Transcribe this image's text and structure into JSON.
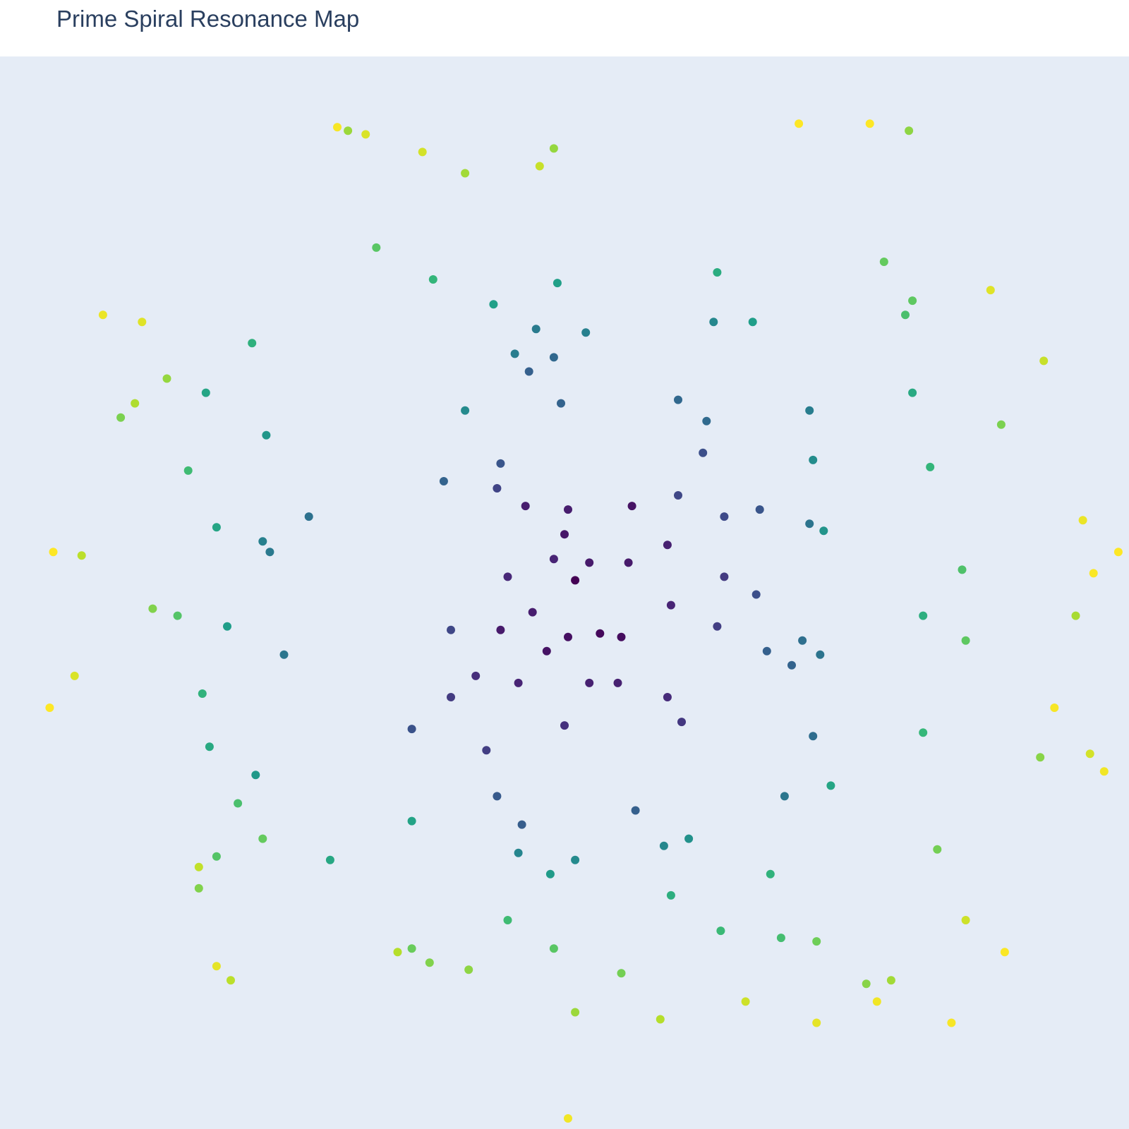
{
  "chart_data": {
    "type": "scatter",
    "title": "Prime Spiral Resonance Map",
    "xlabel": "",
    "ylabel": "",
    "xlim": [
      -16.4,
      15.4
    ],
    "ylim": [
      -15.4,
      14.9
    ],
    "grid": false,
    "legend": "none",
    "colorscale": "viridis",
    "plot_bgcolor": "#e5ecf6",
    "points": [
      [
        -0.2,
        0.1,
        0.0
      ],
      [
        0.5,
        -1.4,
        0.02
      ],
      [
        1.1,
        -1.5,
        0.03
      ],
      [
        -0.4,
        -1.5,
        0.04
      ],
      [
        -1.0,
        -1.9,
        0.05
      ],
      [
        -2.3,
        -1.3,
        0.07
      ],
      [
        1.4,
        2.2,
        0.05
      ],
      [
        -0.5,
        1.4,
        0.06
      ],
      [
        1.3,
        0.6,
        0.07
      ],
      [
        0.2,
        0.6,
        0.07
      ],
      [
        -1.4,
        -0.8,
        0.08
      ],
      [
        -0.4,
        2.1,
        0.08
      ],
      [
        -1.6,
        2.2,
        0.08
      ],
      [
        2.4,
        1.1,
        0.09
      ],
      [
        -1.8,
        -2.8,
        0.1
      ],
      [
        0.2,
        -2.8,
        0.09
      ],
      [
        1.0,
        -2.8,
        0.09
      ],
      [
        2.5,
        -0.6,
        0.1
      ],
      [
        -2.1,
        0.2,
        0.11
      ],
      [
        -0.8,
        0.7,
        0.1
      ],
      [
        2.4,
        -3.2,
        0.12
      ],
      [
        -3.0,
        -2.6,
        0.13
      ],
      [
        -0.5,
        -4.0,
        0.14
      ],
      [
        2.8,
        -3.9,
        0.16
      ],
      [
        -3.7,
        -3.2,
        0.17
      ],
      [
        -2.7,
        -4.7,
        0.18
      ],
      [
        4.0,
        0.2,
        0.17
      ],
      [
        3.8,
        -1.2,
        0.18
      ],
      [
        -2.4,
        2.7,
        0.2
      ],
      [
        -3.7,
        -1.3,
        0.21
      ],
      [
        2.7,
        2.5,
        0.21
      ],
      [
        4.0,
        1.9,
        0.22
      ],
      [
        4.9,
        -0.3,
        0.24
      ],
      [
        -4.8,
        -4.1,
        0.25
      ],
      [
        3.4,
        3.7,
        0.24
      ],
      [
        5.0,
        2.1,
        0.26
      ],
      [
        -2.3,
        3.4,
        0.26
      ],
      [
        -2.4,
        -6.0,
        0.28
      ],
      [
        -1.7,
        -6.8,
        0.29
      ],
      [
        1.5,
        -6.4,
        0.3
      ],
      [
        5.2,
        -1.9,
        0.3
      ],
      [
        5.9,
        -2.3,
        0.31
      ],
      [
        -1.5,
        6.0,
        0.3
      ],
      [
        -3.9,
        2.9,
        0.31
      ],
      [
        -0.6,
        5.1,
        0.31
      ],
      [
        -0.8,
        6.4,
        0.33
      ],
      [
        2.7,
        5.2,
        0.33
      ],
      [
        6.5,
        -4.3,
        0.35
      ],
      [
        3.5,
        4.6,
        0.34
      ],
      [
        6.2,
        -1.6,
        0.36
      ],
      [
        -7.7,
        1.9,
        0.37
      ],
      [
        6.7,
        -2.0,
        0.38
      ],
      [
        6.4,
        1.7,
        0.38
      ],
      [
        -8.4,
        -2.0,
        0.39
      ],
      [
        -8.8,
        0.9,
        0.4
      ],
      [
        5.7,
        -6.0,
        0.39
      ],
      [
        -1.3,
        7.2,
        0.41
      ],
      [
        -1.9,
        6.5,
        0.42
      ],
      [
        0.1,
        7.1,
        0.43
      ],
      [
        6.4,
        4.9,
        0.42
      ],
      [
        -9.0,
        1.2,
        0.43
      ],
      [
        -1.8,
        -7.6,
        0.45
      ],
      [
        2.3,
        -7.4,
        0.46
      ],
      [
        -0.2,
        -7.8,
        0.47
      ],
      [
        3.7,
        7.4,
        0.46
      ],
      [
        -3.3,
        4.9,
        0.47
      ],
      [
        6.5,
        3.5,
        0.48
      ],
      [
        3.0,
        -7.2,
        0.5
      ],
      [
        6.8,
        1.5,
        0.51
      ],
      [
        -8.9,
        4.2,
        0.52
      ],
      [
        -9.2,
        -5.4,
        0.53
      ],
      [
        -0.9,
        -8.2,
        0.54
      ],
      [
        4.8,
        7.4,
        0.55
      ],
      [
        -10.0,
        -1.2,
        0.55
      ],
      [
        -2.5,
        7.9,
        0.56
      ],
      [
        -0.7,
        8.5,
        0.56
      ],
      [
        -4.8,
        -6.7,
        0.57
      ],
      [
        7.0,
        -5.7,
        0.58
      ],
      [
        -10.3,
        1.6,
        0.58
      ],
      [
        -10.6,
        5.4,
        0.58
      ],
      [
        -7.1,
        -7.8,
        0.59
      ],
      [
        9.3,
        5.4,
        0.6
      ],
      [
        -10.5,
        -4.6,
        0.6
      ],
      [
        3.8,
        8.8,
        0.61
      ],
      [
        2.5,
        -8.8,
        0.62
      ],
      [
        9.6,
        -0.9,
        0.62
      ],
      [
        -9.3,
        6.8,
        0.63
      ],
      [
        5.3,
        -8.2,
        0.64
      ],
      [
        -10.7,
        -3.1,
        0.64
      ],
      [
        9.8,
        3.3,
        0.65
      ],
      [
        -4.2,
        8.6,
        0.65
      ],
      [
        9.6,
        -4.2,
        0.66
      ],
      [
        3.9,
        -9.8,
        0.67
      ],
      [
        -2.1,
        -9.5,
        0.68
      ],
      [
        -11.1,
        3.2,
        0.68
      ],
      [
        5.6,
        -10.0,
        0.69
      ],
      [
        -9.7,
        -6.2,
        0.7
      ],
      [
        9.1,
        7.6,
        0.7
      ],
      [
        10.7,
        0.4,
        0.71
      ],
      [
        -11.4,
        -0.9,
        0.72
      ],
      [
        -10.3,
        -7.7,
        0.72
      ],
      [
        -5.8,
        9.5,
        0.73
      ],
      [
        -0.8,
        -10.3,
        0.73
      ],
      [
        10.8,
        -1.6,
        0.74
      ],
      [
        9.3,
        8.0,
        0.74
      ],
      [
        -9.0,
        -7.2,
        0.75
      ],
      [
        8.5,
        9.1,
        0.75
      ],
      [
        -4.8,
        -10.3,
        0.76
      ],
      [
        6.6,
        -10.1,
        0.77
      ],
      [
        1.1,
        -11.0,
        0.78
      ],
      [
        10.0,
        -7.5,
        0.78
      ],
      [
        -13.0,
        4.7,
        0.79
      ],
      [
        -12.1,
        -0.7,
        0.8
      ],
      [
        11.8,
        4.5,
        0.79
      ],
      [
        -10.8,
        -8.6,
        0.8
      ],
      [
        -4.3,
        -10.7,
        0.8
      ],
      [
        8.0,
        -11.3,
        0.81
      ],
      [
        12.9,
        -4.9,
        0.81
      ],
      [
        -3.2,
        -10.9,
        0.82
      ],
      [
        -11.7,
        5.8,
        0.83
      ],
      [
        -0.8,
        12.3,
        0.83
      ],
      [
        9.2,
        12.8,
        0.82
      ],
      [
        -6.6,
        12.8,
        0.84
      ],
      [
        -0.2,
        -12.1,
        0.84
      ],
      [
        -3.3,
        11.6,
        0.85
      ],
      [
        8.7,
        -11.2,
        0.85
      ],
      [
        13.9,
        -0.9,
        0.86
      ],
      [
        -12.6,
        5.1,
        0.87
      ],
      [
        2.2,
        -12.3,
        0.88
      ],
      [
        -5.2,
        -10.4,
        0.88
      ],
      [
        -14.1,
        0.8,
        0.89
      ],
      [
        -9.9,
        -11.2,
        0.89
      ],
      [
        -10.8,
        -8.0,
        0.9
      ],
      [
        -1.2,
        11.8,
        0.91
      ],
      [
        13.0,
        6.3,
        0.91
      ],
      [
        4.6,
        -11.8,
        0.92
      ],
      [
        10.8,
        -9.5,
        0.92
      ],
      [
        -4.5,
        12.2,
        0.93
      ],
      [
        14.3,
        -4.8,
        0.93
      ],
      [
        -6.1,
        12.7,
        0.94
      ],
      [
        -14.3,
        -2.6,
        0.94
      ],
      [
        -12.4,
        7.4,
        0.95
      ],
      [
        11.5,
        8.3,
        0.95
      ],
      [
        6.6,
        -12.4,
        0.96
      ],
      [
        -10.3,
        -10.8,
        0.96
      ],
      [
        14.1,
        1.8,
        0.97
      ],
      [
        -13.5,
        7.6,
        0.97
      ],
      [
        14.7,
        -5.3,
        0.98
      ],
      [
        -0.4,
        -15.1,
        0.98
      ],
      [
        8.3,
        -11.8,
        0.98
      ],
      [
        -6.9,
        12.9,
        0.99
      ],
      [
        13.3,
        -3.5,
        0.99
      ],
      [
        11.9,
        -10.4,
        0.995
      ],
      [
        14.4,
        0.3,
        0.995
      ],
      [
        15.1,
        0.9,
        1.0
      ],
      [
        8.1,
        13.0,
        1.0
      ],
      [
        -14.9,
        0.9,
        1.0
      ],
      [
        -15.0,
        -3.5,
        1.0
      ],
      [
        10.4,
        -12.4,
        0.99
      ],
      [
        6.1,
        13.0,
        1.0
      ]
    ]
  }
}
